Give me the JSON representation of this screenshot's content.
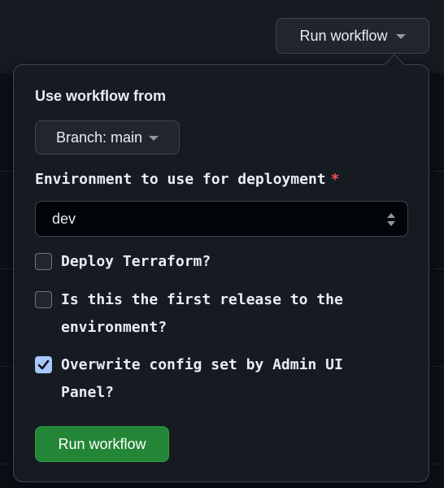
{
  "header": {
    "run_button_label": "Run workflow"
  },
  "popover": {
    "workflow_source_label": "Use workflow from",
    "branch_button_label": "Branch: main",
    "environment": {
      "label": "Environment to use for deployment",
      "required_marker": "*",
      "selected_value": "dev"
    },
    "options": [
      {
        "label": "Deploy Terraform?",
        "checked": false
      },
      {
        "label": "Is this the first release to the environment?",
        "checked": false
      },
      {
        "label": "Overwrite config set by Admin UI Panel?",
        "checked": true
      }
    ],
    "submit_label": "Run workflow"
  },
  "colors": {
    "background": "#0d1117",
    "surface": "#161b22",
    "border": "#3d444d",
    "accent_green": "#238636",
    "required_red": "#f85149",
    "checkbox_checked": "#a8c7fa"
  },
  "icons": {
    "trigger_caret": "triangle-down-icon",
    "branch_caret": "triangle-down-icon",
    "select_arrows": "up-down-arrows-icon",
    "check_mark": "check-icon"
  }
}
